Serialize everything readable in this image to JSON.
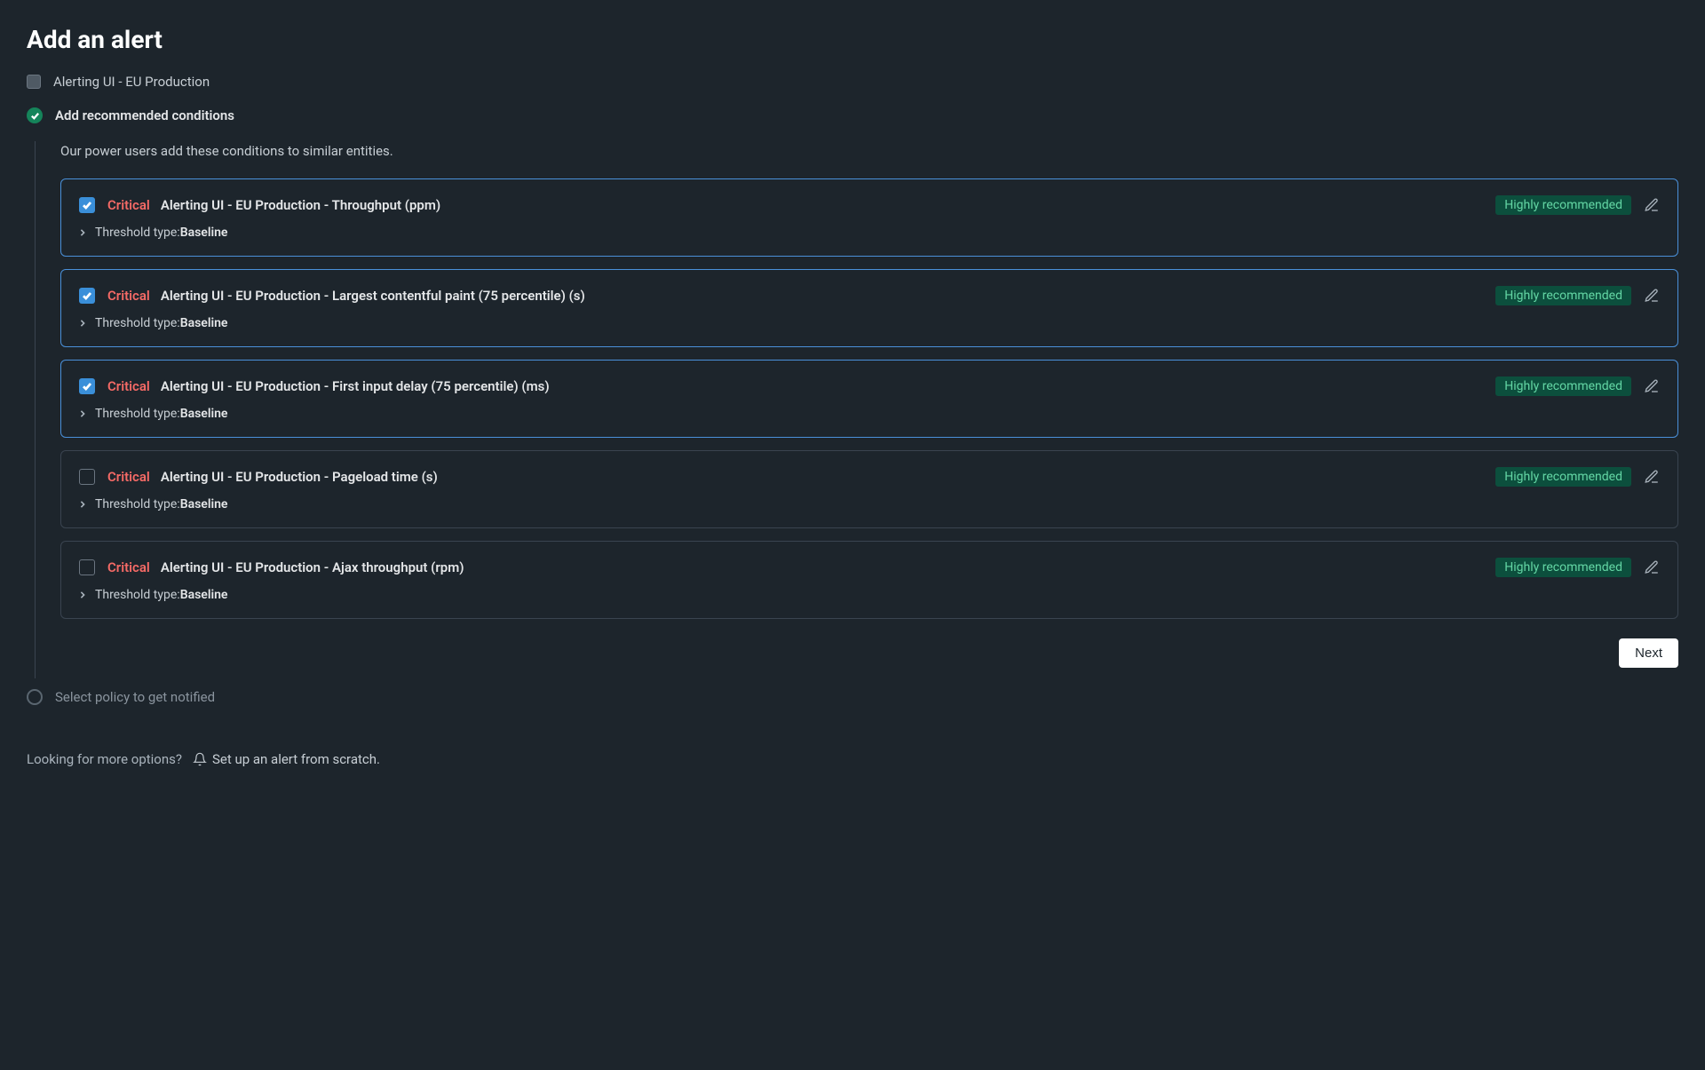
{
  "page_title": "Add an alert",
  "step1": {
    "label": "Alerting UI - EU Production"
  },
  "step2": {
    "label": "Add recommended conditions",
    "description": "Our power users add these conditions to similar entities."
  },
  "step3": {
    "label": "Select policy to get notified"
  },
  "conditions": [
    {
      "checked": true,
      "severity": "Critical",
      "name": "Alerting UI - EU Production - Throughput (ppm)",
      "badge": "Highly recommended",
      "threshold_label": "Threshold type: ",
      "threshold_value": "Baseline"
    },
    {
      "checked": true,
      "severity": "Critical",
      "name": "Alerting UI - EU Production - Largest contentful paint (75 percentile) (s)",
      "badge": "Highly recommended",
      "threshold_label": "Threshold type: ",
      "threshold_value": "Baseline"
    },
    {
      "checked": true,
      "severity": "Critical",
      "name": "Alerting UI - EU Production - First input delay (75 percentile) (ms)",
      "badge": "Highly recommended",
      "threshold_label": "Threshold type: ",
      "threshold_value": "Baseline"
    },
    {
      "checked": false,
      "severity": "Critical",
      "name": "Alerting UI - EU Production - Pageload time (s)",
      "badge": "Highly recommended",
      "threshold_label": "Threshold type: ",
      "threshold_value": "Baseline"
    },
    {
      "checked": false,
      "severity": "Critical",
      "name": "Alerting UI - EU Production - Ajax throughput (rpm)",
      "badge": "Highly recommended",
      "threshold_label": "Threshold type: ",
      "threshold_value": "Baseline"
    }
  ],
  "next_button": "Next",
  "footer": {
    "text": "Looking for more options?",
    "link": "Set up an alert from scratch."
  }
}
